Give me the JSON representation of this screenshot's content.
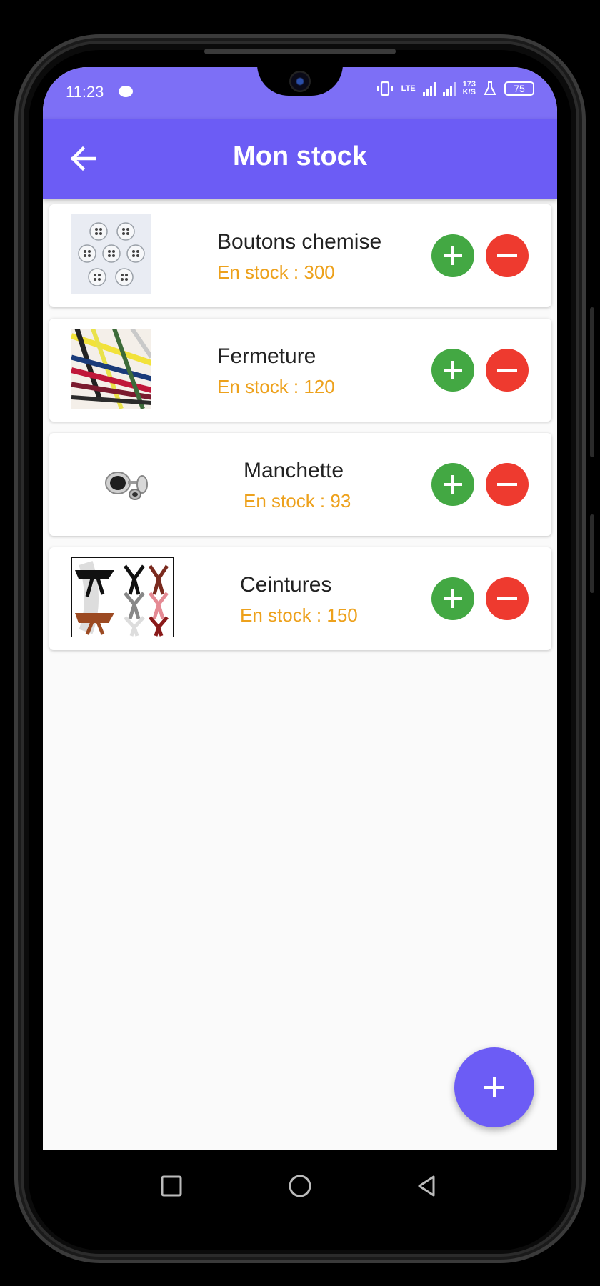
{
  "status_bar": {
    "time": "11:23",
    "network": "LTE",
    "speed_value": "173",
    "speed_unit": "K/S",
    "battery": "75"
  },
  "app_bar": {
    "title": "Mon stock",
    "back_icon": "arrow-left-icon"
  },
  "items": [
    {
      "name": "Boutons chemise",
      "stock": "En stock : 300",
      "image": "shirt-buttons-photo"
    },
    {
      "name": "Fermeture",
      "stock": "En stock : 120",
      "image": "zippers-photo"
    },
    {
      "name": "Manchette",
      "stock": "En stock : 93",
      "image": "cufflinks-photo"
    },
    {
      "name": "Ceintures",
      "stock": "En stock : 150",
      "image": "belts-photo"
    }
  ],
  "actions": {
    "increment_icon": "plus-icon",
    "decrement_icon": "minus-icon",
    "fab_icon": "plus-icon"
  },
  "colors": {
    "primary": "#6c5cf5",
    "status_bar": "#7d6ff6",
    "stock_text": "#eda11c",
    "increment": "#43a843",
    "decrement": "#ee3a2f"
  },
  "nav": {
    "recents_icon": "square-icon",
    "home_icon": "circle-icon",
    "back_icon": "triangle-back-icon"
  }
}
